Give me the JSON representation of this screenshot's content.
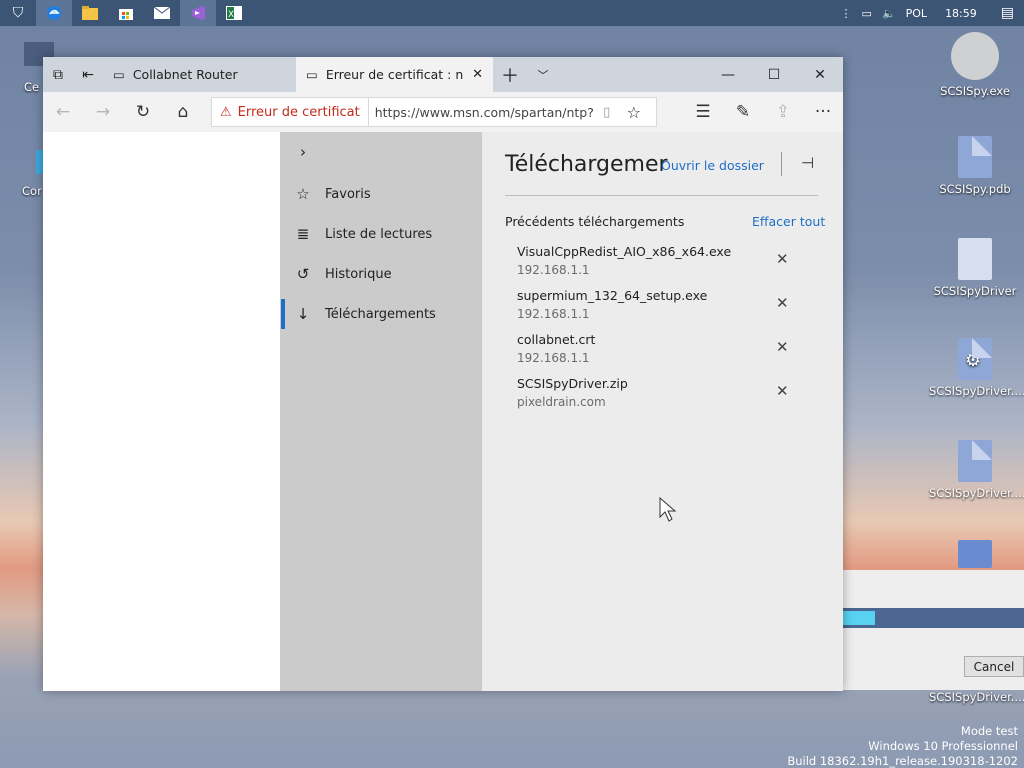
{
  "taskbar": {
    "icons": [
      "shield-icon",
      "edge-icon",
      "file-explorer-icon",
      "store-icon",
      "mail-icon",
      "visual-studio-icon",
      "excel-icon"
    ],
    "lang": "POL",
    "time": "18:59"
  },
  "desktop": {
    "left_fragments": [
      "Ce",
      "Cor"
    ],
    "icons": [
      {
        "label": "SCSISpy.exe"
      },
      {
        "label": "SCSISpy.pdb"
      },
      {
        "label": "SCSISpyDriver"
      },
      {
        "label": "SCSISpyDriver...."
      },
      {
        "label": "SCSISpyDriver...."
      },
      {
        "label": "SCSISpyDriver...."
      }
    ],
    "watermark": [
      "Mode test",
      "Windows 10 Professionnel",
      "Build 18362.19h1_release.190318-1202"
    ]
  },
  "installer": {
    "cancel_label": "Cancel"
  },
  "browser": {
    "tabs": [
      {
        "title": "Collabnet Router",
        "active": false
      },
      {
        "title": "Erreur de certificat : nav",
        "active": true
      }
    ],
    "address": {
      "cert_warning": "Erreur de certificat",
      "url": "https://www.msn.com/spartan/ntp?loc"
    },
    "hub": {
      "items": [
        {
          "label": "Favoris",
          "icon": "favorites-icon"
        },
        {
          "label": "Liste de lectures",
          "icon": "reading-list-icon"
        },
        {
          "label": "Historique",
          "icon": "history-icon"
        },
        {
          "label": "Téléchargements",
          "icon": "downloads-icon",
          "selected": true
        }
      ]
    },
    "downloads": {
      "title": "Téléchargemer",
      "open_folder": "Ouvrir le dossier",
      "section": "Précédents téléchargements",
      "clear_all": "Effacer tout",
      "items": [
        {
          "name": "VisualCppRedist_AIO_x86_x64.exe",
          "source": "192.168.1.1"
        },
        {
          "name": "supermium_132_64_setup.exe",
          "source": "192.168.1.1"
        },
        {
          "name": "collabnet.crt",
          "source": "192.168.1.1"
        },
        {
          "name": "SCSISpyDriver.zip",
          "source": "pixeldrain.com"
        }
      ]
    }
  }
}
